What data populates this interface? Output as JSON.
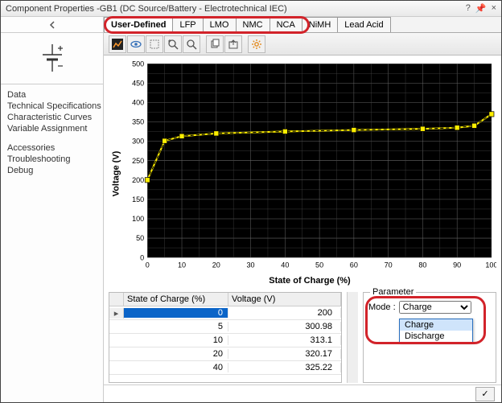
{
  "window": {
    "title": "Component Properties -GB1 (DC Source/Battery - Electrotechnical IEC)",
    "buttons": {
      "help": "?",
      "pin": "📌",
      "close": "×"
    }
  },
  "nav": {
    "items": [
      "Data",
      "Technical Specifications",
      "Characteristic Curves",
      "Variable Assignment"
    ],
    "items2": [
      "Accessories",
      "Troubleshooting",
      "Debug"
    ]
  },
  "tabs": [
    "User-Defined",
    "LFP",
    "LMO",
    "NMC",
    "NCA",
    "NiMH",
    "Lead Acid"
  ],
  "tabs_selected": 0,
  "chart": {
    "ylabel": "Voltage (V)",
    "xlabel": "State of Charge (%)"
  },
  "chart_data": {
    "type": "line",
    "title": "",
    "xlabel": "State of Charge (%)",
    "ylabel": "Voltage (V)",
    "xlim": [
      0,
      100
    ],
    "ylim": [
      0,
      500
    ],
    "xticks": [
      0,
      10,
      20,
      30,
      40,
      50,
      60,
      70,
      80,
      90,
      100
    ],
    "yticks": [
      0,
      50,
      100,
      150,
      200,
      250,
      300,
      350,
      400,
      450,
      500
    ],
    "series": [
      {
        "name": "Voltage",
        "x": [
          0,
          5,
          10,
          20,
          40,
          60,
          80,
          90,
          95,
          100
        ],
        "values": [
          200,
          300.98,
          313.1,
          320.17,
          325.22,
          329,
          332,
          335,
          340,
          370
        ]
      }
    ]
  },
  "table": {
    "headers": {
      "soc": "State of Charge (%)",
      "v": "Voltage (V)"
    },
    "rows": [
      {
        "soc": "0",
        "v": "200"
      },
      {
        "soc": "5",
        "v": "300.98"
      },
      {
        "soc": "10",
        "v": "313.1"
      },
      {
        "soc": "20",
        "v": "320.17"
      },
      {
        "soc": "40",
        "v": "325.22"
      }
    ],
    "selected": 0
  },
  "param": {
    "legend": "Parameter",
    "mode_label": "Mode :",
    "mode_value": "Charge",
    "options": [
      "Charge",
      "Discharge"
    ]
  },
  "footer": {
    "ok": "✓"
  }
}
